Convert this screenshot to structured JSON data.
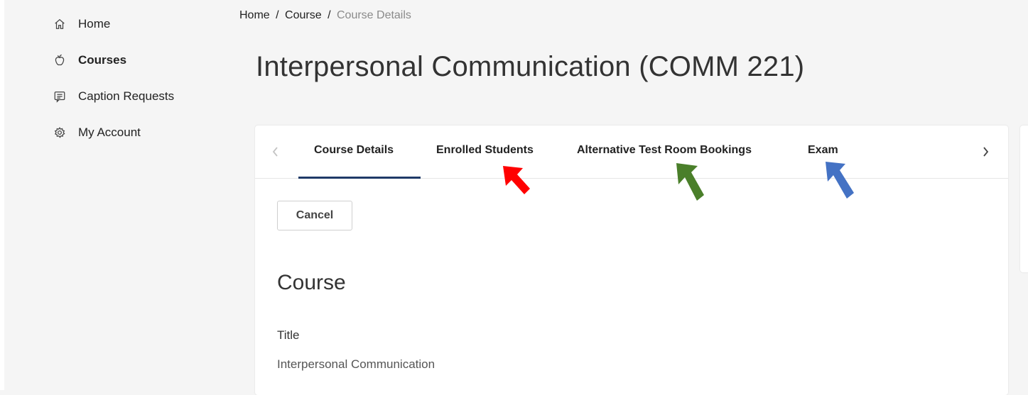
{
  "sidebar": {
    "items": [
      {
        "label": "Home",
        "icon": "home-icon",
        "active": false
      },
      {
        "label": "Courses",
        "icon": "apple-icon",
        "active": true
      },
      {
        "label": "Caption Requests",
        "icon": "caption-icon",
        "active": false
      },
      {
        "label": "My Account",
        "icon": "gear-icon",
        "active": false
      }
    ]
  },
  "breadcrumb": {
    "items": [
      "Home",
      "Course",
      "Course Details"
    ],
    "separator": "/"
  },
  "page": {
    "title": "Interpersonal Communication (COMM 221)"
  },
  "tabs": {
    "items": [
      {
        "label": "Course Details",
        "active": true
      },
      {
        "label": "Enrolled Students",
        "active": false
      },
      {
        "label": "Alternative Test Room Bookings",
        "active": false
      },
      {
        "label": "Exam",
        "active": false
      }
    ]
  },
  "form": {
    "cancel_label": "Cancel",
    "section_title": "Course",
    "title_label": "Title",
    "title_value": "Interpersonal Communication"
  },
  "annotations": {
    "arrow_colors": [
      "#ff0000",
      "#4a7f2a",
      "#4472c4"
    ]
  },
  "colors": {
    "tab_indicator": "#1f3a68",
    "background": "#f5f5f5"
  }
}
